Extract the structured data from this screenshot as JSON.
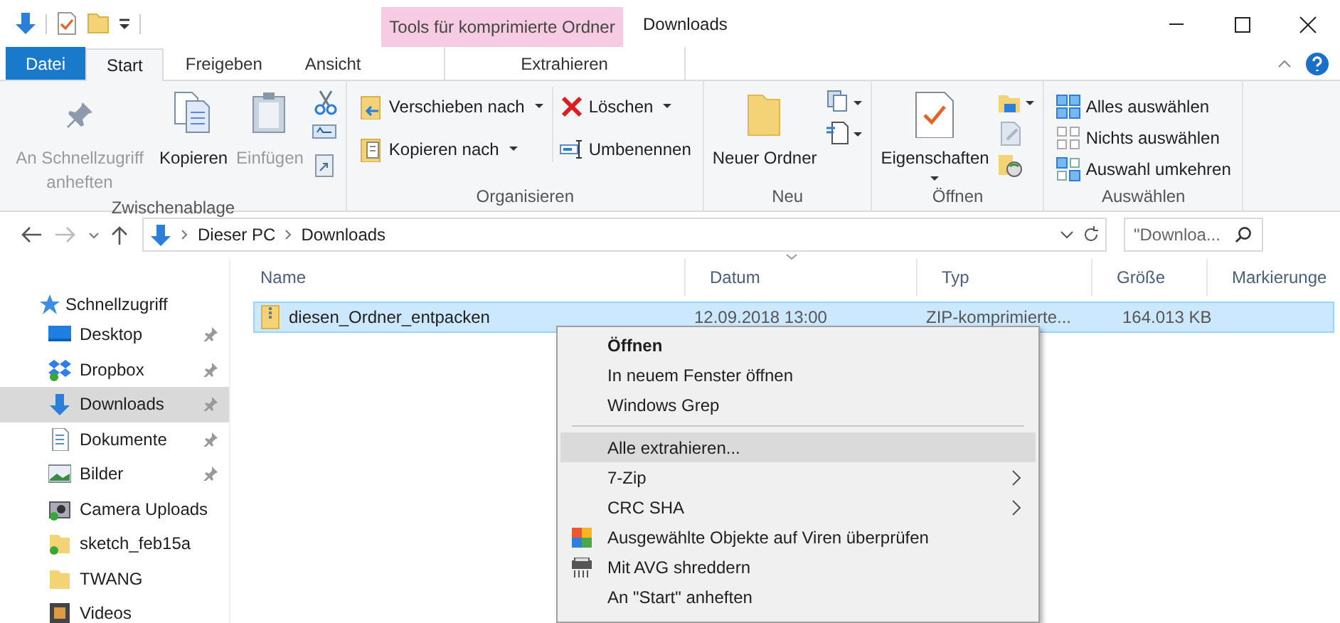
{
  "window": {
    "title": "Downloads",
    "context_tab_group": "Tools für komprimierte Ordner"
  },
  "ribbon_tabs": [
    {
      "label": "Datei",
      "kind": "file",
      "selected": false
    },
    {
      "label": "Start",
      "kind": "tab",
      "selected": true
    },
    {
      "label": "Freigeben",
      "kind": "tab",
      "selected": false
    },
    {
      "label": "Ansicht",
      "kind": "tab",
      "selected": false
    },
    {
      "label": "Extrahieren",
      "kind": "context",
      "selected": false
    }
  ],
  "ribbon_groups": [
    {
      "label": "Zwischenablage",
      "columns": [
        {
          "kind": "large",
          "items": [
            {
              "label": "An Schnellzugriff anheften",
              "disabled": true
            }
          ]
        },
        {
          "kind": "large",
          "items": [
            {
              "label": "Kopieren",
              "disabled": false
            }
          ]
        },
        {
          "kind": "large",
          "items": [
            {
              "label": "Einfügen",
              "disabled": true
            }
          ]
        },
        {
          "kind": "icons",
          "items": [
            {
              "dropdown": false
            },
            {
              "dropdown": false
            },
            {
              "dropdown": false
            }
          ]
        }
      ]
    },
    {
      "label": "Organisieren",
      "columns": [
        {
          "kind": "small",
          "items": [
            {
              "label": "Verschieben nach",
              "dropdown": true
            },
            {
              "label": "Kopieren nach",
              "dropdown": true
            }
          ]
        },
        {
          "kind": "small",
          "items": [
            {
              "label": "Löschen",
              "dropdown": true
            },
            {
              "label": "Umbenennen",
              "dropdown": false
            }
          ]
        }
      ]
    },
    {
      "label": "Neu",
      "columns": [
        {
          "kind": "large",
          "items": [
            {
              "label": "Neuer Ordner",
              "disabled": false
            }
          ]
        },
        {
          "kind": "icons",
          "items": [
            {
              "dropdown": true
            },
            {
              "dropdown": true
            }
          ]
        }
      ]
    },
    {
      "label": "Öffnen",
      "columns": [
        {
          "kind": "large",
          "items": [
            {
              "label": "Eigenschaften",
              "disabled": false,
              "dropdown": true
            }
          ]
        },
        {
          "kind": "icons",
          "items": [
            {
              "dropdown": true
            },
            {
              "dropdown": false
            },
            {
              "dropdown": false
            }
          ]
        }
      ]
    },
    {
      "label": "Auswählen",
      "columns": [
        {
          "kind": "small",
          "items": [
            {
              "label": "Alles auswählen",
              "dropdown": false
            },
            {
              "label": "Nichts auswählen",
              "dropdown": false
            },
            {
              "label": "Auswahl umkehren",
              "dropdown": false
            }
          ]
        }
      ]
    }
  ],
  "navigation": {
    "back_disabled": false,
    "forward_disabled": true,
    "breadcrumb": [
      "Dieser PC",
      "Downloads"
    ],
    "search": {
      "placeholder": "\"Downloa..."
    }
  },
  "sidebar": {
    "header": "Schnellzugriff",
    "items": [
      {
        "label": "Desktop",
        "kind": "desktop",
        "pinned": true,
        "selected": false
      },
      {
        "label": "Dropbox",
        "kind": "dropbox",
        "pinned": true,
        "selected": false
      },
      {
        "label": "Downloads",
        "kind": "downloads",
        "pinned": true,
        "selected": true
      },
      {
        "label": "Dokumente",
        "kind": "documents",
        "pinned": true,
        "selected": false
      },
      {
        "label": "Bilder",
        "kind": "pictures",
        "pinned": true,
        "selected": false
      },
      {
        "label": "Camera Uploads",
        "kind": "camera",
        "pinned": false,
        "selected": false
      },
      {
        "label": "sketch_feb15a",
        "kind": "synced-folder",
        "pinned": false,
        "selected": false
      },
      {
        "label": "TWANG",
        "kind": "folder",
        "pinned": false,
        "selected": false
      },
      {
        "label": "Videos",
        "kind": "videos",
        "pinned": false,
        "selected": false
      }
    ]
  },
  "table": {
    "columns": [
      {
        "label": "Name",
        "sorted": false
      },
      {
        "label": "Datum",
        "sorted": true
      },
      {
        "label": "Typ",
        "sorted": false
      },
      {
        "label": "Größe",
        "sorted": false
      },
      {
        "label": "Markierunge",
        "sorted": false
      }
    ],
    "rows": [
      {
        "cells": [
          "diesen_Ordner_entpacken",
          "12.09.2018 13:00",
          "ZIP-komprimierte...",
          "164.013 KB",
          null
        ],
        "selected": true
      }
    ]
  },
  "context_menu": {
    "items": [
      {
        "kind": "command",
        "label": "Öffnen",
        "bold": true,
        "submenu": false,
        "selected": false
      },
      {
        "kind": "command",
        "label": "In neuem Fenster öffnen",
        "bold": false,
        "submenu": false,
        "selected": false
      },
      {
        "kind": "command",
        "label": "Windows Grep",
        "bold": false,
        "submenu": false,
        "selected": false
      },
      {
        "kind": "separator"
      },
      {
        "kind": "command",
        "label": "Alle extrahieren...",
        "bold": false,
        "submenu": false,
        "selected": true
      },
      {
        "kind": "command",
        "label": "7-Zip",
        "bold": false,
        "submenu": true,
        "selected": false
      },
      {
        "kind": "command",
        "label": "CRC SHA",
        "bold": false,
        "submenu": true,
        "selected": false
      },
      {
        "kind": "scan",
        "label": "Ausgewählte Objekte auf Viren überprüfen",
        "bold": false,
        "submenu": false,
        "selected": false
      },
      {
        "kind": "shred",
        "label": "Mit AVG shreddern",
        "bold": false,
        "submenu": false,
        "selected": false
      },
      {
        "kind": "command",
        "label": "An \"Start\" anheften",
        "bold": false,
        "submenu": false,
        "selected": false
      }
    ]
  }
}
